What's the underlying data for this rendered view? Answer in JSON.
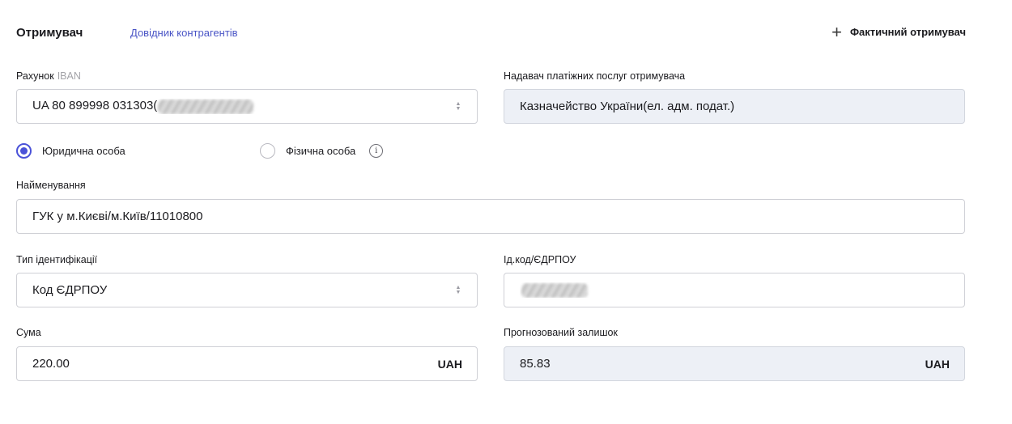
{
  "header": {
    "title": "Отримувач",
    "directory_link": "Довідник контрагентів",
    "add_actual_recipient": "Фактичний отримувач",
    "add_icon": "+"
  },
  "account": {
    "label": "Рахунок",
    "label_hint": "IBAN",
    "value": "UA 80 899998 031303("
  },
  "payment_provider": {
    "label": "Надавач платіжних послуг отримувача",
    "value": "Казначейство України(ел. адм. подат.)"
  },
  "entity_type": {
    "legal": "Юридична особа",
    "individual": "Фізична особа",
    "selected": "legal",
    "info_icon": "i"
  },
  "name": {
    "label": "Найменування",
    "value": "ГУК у м.Києві/м.Київ/11010800"
  },
  "id_type": {
    "label": "Тип ідентифікації",
    "value": "Код ЄДРПОУ"
  },
  "id_code": {
    "label": "Ід.код/ЄДРПОУ",
    "value": ""
  },
  "amount": {
    "label": "Сума",
    "value": "220.00",
    "currency": "UAH"
  },
  "forecast_balance": {
    "label": "Прогнозований залишок",
    "value": "85.83",
    "currency": "UAH"
  },
  "colors": {
    "accent": "#4a52d8",
    "link": "#4a55c6",
    "readonly_bg": "#edf0f6",
    "border": "#cfd0d6"
  },
  "icons": {
    "add": "plus-icon",
    "select": "chevron-updown-icon",
    "info": "info-icon"
  }
}
